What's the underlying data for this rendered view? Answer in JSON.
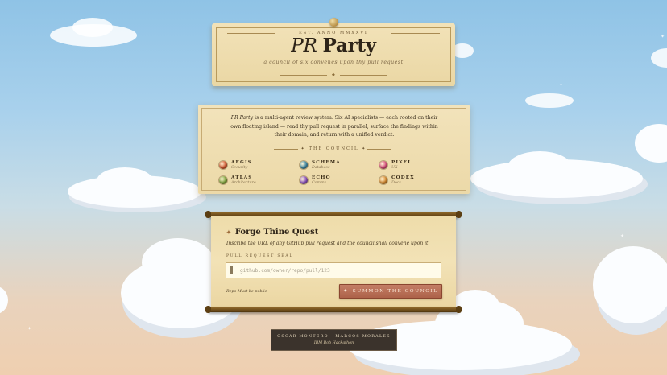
{
  "header": {
    "established": "EST. ANNO MMXXVI",
    "title_italic": "PR",
    "title_bold": "Party",
    "tagline": "a council of six convenes upon thy pull request"
  },
  "about": {
    "lead": "PR Party",
    "text": " is a multi-agent review system. Six AI specialists — each rooted on their own floating island — read thy pull request in parallel, surface the findings within their domain, and return with a unified verdict.",
    "council_heading": "THE COUNCIL",
    "members": [
      {
        "name": "AEGIS",
        "role": "Security",
        "color": "#d4552e"
      },
      {
        "name": "SCHEMA",
        "role": "Database",
        "color": "#3f8aa8"
      },
      {
        "name": "PIXEL",
        "role": "UX",
        "color": "#d8497a"
      },
      {
        "name": "ATLAS",
        "role": "Architecture",
        "color": "#7ea43a"
      },
      {
        "name": "ECHO",
        "role": "Comms",
        "color": "#8c52c4"
      },
      {
        "name": "CODEX",
        "role": "Docs",
        "color": "#d88a2e"
      }
    ]
  },
  "quest": {
    "title": "Forge Thine Quest",
    "subtitle": "Inscribe the URL of any GitHub pull request and the council shall convene upon it.",
    "field_label": "PULL REQUEST SEAL",
    "input_placeholder": "github.com/owner/repo/pull/123",
    "input_value": "",
    "note": "Repo Must be public",
    "button_label": "SUMMON THE COUNCIL",
    "button_icon": "✦"
  },
  "footer": {
    "authors": "OSCAR MONTERO · MARCOS MORALES",
    "event": "IBM Bob Hackathon"
  },
  "colors": {
    "parchment": "#f0dfb0",
    "accent_button": "#b8694f",
    "ink": "#2e2418"
  }
}
